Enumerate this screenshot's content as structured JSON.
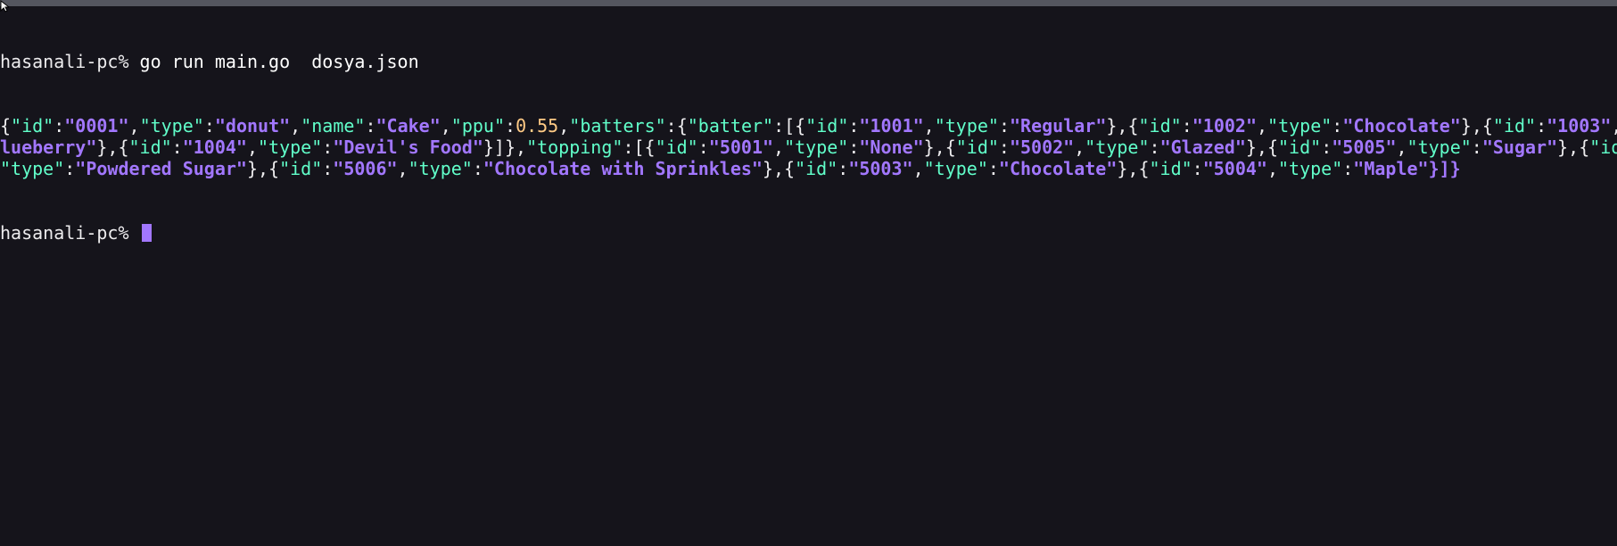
{
  "terminal": {
    "prompt": "hasanali-pc%",
    "command": "go run main.go  dosya.json",
    "output_lines": [
      [
        {
          "t": "p",
          "v": "{"
        },
        {
          "t": "k",
          "v": "\"id\""
        },
        {
          "t": "p",
          "v": ":"
        },
        {
          "t": "s",
          "v": "\"0001\""
        },
        {
          "t": "p",
          "v": ","
        },
        {
          "t": "k",
          "v": "\"type\""
        },
        {
          "t": "p",
          "v": ":"
        },
        {
          "t": "s",
          "v": "\"donut\""
        },
        {
          "t": "p",
          "v": ","
        },
        {
          "t": "k",
          "v": "\"name\""
        },
        {
          "t": "p",
          "v": ":"
        },
        {
          "t": "s",
          "v": "\"Cake\""
        },
        {
          "t": "p",
          "v": ","
        },
        {
          "t": "k",
          "v": "\"ppu\""
        },
        {
          "t": "p",
          "v": ":"
        },
        {
          "t": "n",
          "v": "0.55"
        },
        {
          "t": "p",
          "v": ","
        },
        {
          "t": "k",
          "v": "\"batters\""
        },
        {
          "t": "p",
          "v": ":{"
        },
        {
          "t": "k",
          "v": "\"batter\""
        },
        {
          "t": "p",
          "v": ":[{"
        },
        {
          "t": "k",
          "v": "\"id\""
        },
        {
          "t": "p",
          "v": ":"
        },
        {
          "t": "s",
          "v": "\"1001\""
        },
        {
          "t": "p",
          "v": ","
        },
        {
          "t": "k",
          "v": "\"type\""
        },
        {
          "t": "p",
          "v": ":"
        },
        {
          "t": "s",
          "v": "\"Regular\""
        },
        {
          "t": "p",
          "v": "},{"
        },
        {
          "t": "k",
          "v": "\"id\""
        },
        {
          "t": "p",
          "v": ":"
        },
        {
          "t": "s",
          "v": "\"1002\""
        },
        {
          "t": "p",
          "v": ","
        },
        {
          "t": "k",
          "v": "\"type\""
        },
        {
          "t": "p",
          "v": ":"
        },
        {
          "t": "s",
          "v": "\"Chocolate\""
        },
        {
          "t": "p",
          "v": "},{"
        },
        {
          "t": "k",
          "v": "\"id\""
        },
        {
          "t": "p",
          "v": ":"
        },
        {
          "t": "s",
          "v": "\"1003\""
        },
        {
          "t": "p",
          "v": ","
        }
      ],
      [
        {
          "t": "s",
          "v": "lueberry\""
        },
        {
          "t": "p",
          "v": "},{"
        },
        {
          "t": "k",
          "v": "\"id\""
        },
        {
          "t": "p",
          "v": ":"
        },
        {
          "t": "s",
          "v": "\"1004\""
        },
        {
          "t": "p",
          "v": ","
        },
        {
          "t": "k",
          "v": "\"type\""
        },
        {
          "t": "p",
          "v": ":"
        },
        {
          "t": "s",
          "v": "\"Devil's Food\""
        },
        {
          "t": "p",
          "v": "}]},"
        },
        {
          "t": "k",
          "v": "\"topping\""
        },
        {
          "t": "p",
          "v": ":[{"
        },
        {
          "t": "k",
          "v": "\"id\""
        },
        {
          "t": "p",
          "v": ":"
        },
        {
          "t": "s",
          "v": "\"5001\""
        },
        {
          "t": "p",
          "v": ","
        },
        {
          "t": "k",
          "v": "\"type\""
        },
        {
          "t": "p",
          "v": ":"
        },
        {
          "t": "s",
          "v": "\"None\""
        },
        {
          "t": "p",
          "v": "},{"
        },
        {
          "t": "k",
          "v": "\"id\""
        },
        {
          "t": "p",
          "v": ":"
        },
        {
          "t": "s",
          "v": "\"5002\""
        },
        {
          "t": "p",
          "v": ","
        },
        {
          "t": "k",
          "v": "\"type\""
        },
        {
          "t": "p",
          "v": ":"
        },
        {
          "t": "s",
          "v": "\"Glazed\""
        },
        {
          "t": "p",
          "v": "},{"
        },
        {
          "t": "k",
          "v": "\"id\""
        },
        {
          "t": "p",
          "v": ":"
        },
        {
          "t": "s",
          "v": "\"5005\""
        },
        {
          "t": "p",
          "v": ","
        },
        {
          "t": "k",
          "v": "\"type\""
        },
        {
          "t": "p",
          "v": ":"
        },
        {
          "t": "s",
          "v": "\"Sugar\""
        },
        {
          "t": "p",
          "v": "},{"
        },
        {
          "t": "k",
          "v": "\"id"
        }
      ],
      [
        {
          "t": "k",
          "v": "\"type\""
        },
        {
          "t": "p",
          "v": ":"
        },
        {
          "t": "s",
          "v": "\"Powdered Sugar\""
        },
        {
          "t": "p",
          "v": "},{"
        },
        {
          "t": "k",
          "v": "\"id\""
        },
        {
          "t": "p",
          "v": ":"
        },
        {
          "t": "s",
          "v": "\"5006\""
        },
        {
          "t": "p",
          "v": ","
        },
        {
          "t": "k",
          "v": "\"type\""
        },
        {
          "t": "p",
          "v": ":"
        },
        {
          "t": "s",
          "v": "\"Chocolate with Sprinkles\""
        },
        {
          "t": "p",
          "v": "},{"
        },
        {
          "t": "k",
          "v": "\"id\""
        },
        {
          "t": "p",
          "v": ":"
        },
        {
          "t": "s",
          "v": "\"5003\""
        },
        {
          "t": "p",
          "v": ","
        },
        {
          "t": "k",
          "v": "\"type\""
        },
        {
          "t": "p",
          "v": ":"
        },
        {
          "t": "s",
          "v": "\"Chocolate\""
        },
        {
          "t": "p",
          "v": "},{"
        },
        {
          "t": "k",
          "v": "\"id\""
        },
        {
          "t": "p",
          "v": ":"
        },
        {
          "t": "s",
          "v": "\"5004\""
        },
        {
          "t": "p",
          "v": ","
        },
        {
          "t": "k",
          "v": "\"type\""
        },
        {
          "t": "p",
          "v": ":"
        },
        {
          "t": "s",
          "v": "\"Maple\""
        },
        {
          "t": "s",
          "v": "}]}"
        }
      ]
    ],
    "cursor_icon": "mouse-pointer-icon",
    "colors": {
      "background": "#15141b",
      "key": "#61ffca",
      "string": "#a277ff",
      "number": "#ffca85",
      "punct": "#edecee",
      "cursor": "#a277ff"
    }
  }
}
